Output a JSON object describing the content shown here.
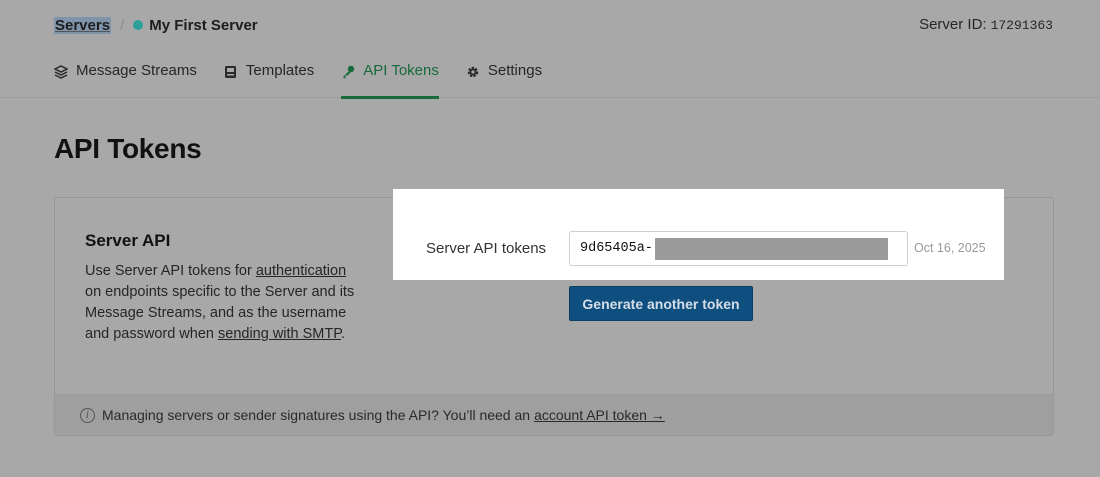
{
  "breadcrumb": {
    "root": "Servers",
    "separator": "/",
    "current": "My First Server",
    "status_color": "#2f9f9a"
  },
  "server_id": {
    "label": "Server ID:",
    "value": "17291363"
  },
  "tabs": [
    {
      "label": "Message Streams",
      "icon": "stack-icon",
      "active": false
    },
    {
      "label": "Templates",
      "icon": "template-icon",
      "active": false
    },
    {
      "label": "API Tokens",
      "icon": "key-icon",
      "active": true
    },
    {
      "label": "Settings",
      "icon": "gear-icon",
      "active": false
    }
  ],
  "page_title": "API Tokens",
  "card": {
    "heading": "Server API",
    "desc_part1": "Use Server API tokens for ",
    "desc_link1": "authentication",
    "desc_part2": " on endpoints specific to the Server and its Message Streams, and as the username and password when ",
    "desc_link2": "sending with SMTP",
    "desc_part3": ".",
    "footer_text": "Managing servers or sender signatures using the API? You’ll need an",
    "footer_link": "account API token →"
  },
  "tokens": {
    "label": "Server API tokens",
    "token_visible": "9d65405a-",
    "date": "Oct 16, 2025",
    "generate_button": "Generate another token"
  },
  "colors": {
    "accent_green": "#166a3c",
    "button_blue": "#0f4f7f"
  }
}
